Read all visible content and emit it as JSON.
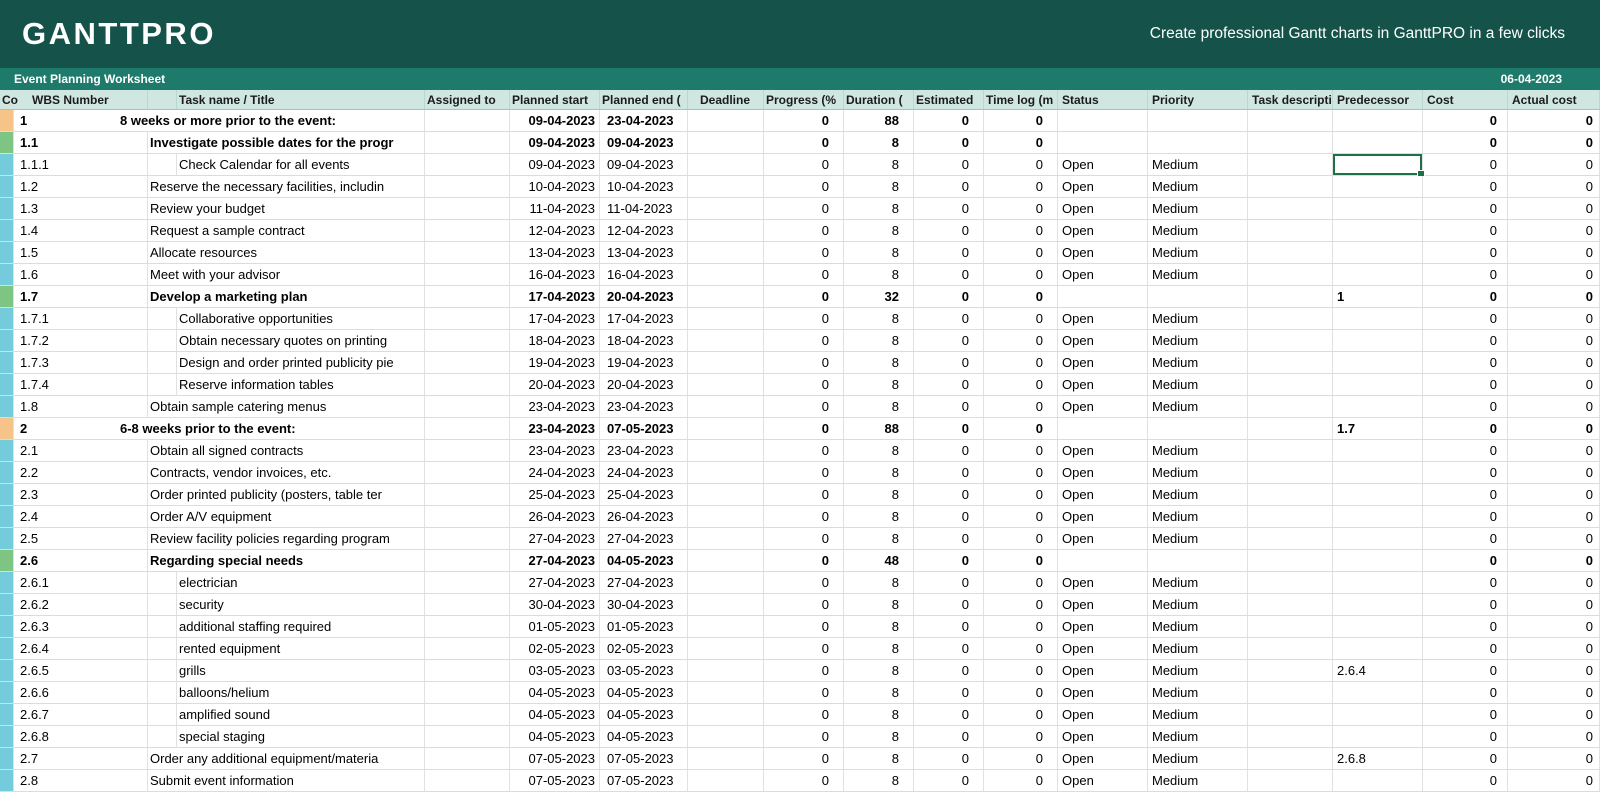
{
  "brand": {
    "logo": "GANTTPRO",
    "tagline": "Create professional Gantt charts in GanttPRO in a few clicks"
  },
  "title_bar": {
    "title": "Event Planning Worksheet",
    "date": "06-04-2023"
  },
  "colors": {
    "orange": "#F6C489",
    "green": "#7EC584",
    "blue": "#74CBDB",
    "top_bar": "#15524A",
    "title_bar": "#1E7A6A",
    "header_row_bg": "#CFE6E1",
    "selection_border": "#1E7145",
    "gridline": "#D9D9D9"
  },
  "table": {
    "columns": [
      {
        "key": "color",
        "label": "Co"
      },
      {
        "key": "wbs",
        "label": "WBS Number"
      },
      {
        "key": "indent",
        "label": ""
      },
      {
        "key": "task",
        "label": "Task name / Title"
      },
      {
        "key": "assigned",
        "label": "Assigned to"
      },
      {
        "key": "planned_start",
        "label": "Planned start"
      },
      {
        "key": "planned_end",
        "label": "Planned end ("
      },
      {
        "key": "deadline",
        "label": "Deadline"
      },
      {
        "key": "progress",
        "label": "Progress (%"
      },
      {
        "key": "duration",
        "label": "Duration  ("
      },
      {
        "key": "estimated",
        "label": "Estimated"
      },
      {
        "key": "timelog",
        "label": "Time log (m"
      },
      {
        "key": "status",
        "label": "Status"
      },
      {
        "key": "priority",
        "label": "Priority"
      },
      {
        "key": "task_desc",
        "label": "Task descripti"
      },
      {
        "key": "predecessor",
        "label": "Predecessor"
      },
      {
        "key": "cost",
        "label": "Cost"
      },
      {
        "key": "actual_cost",
        "label": "Actual cost"
      }
    ],
    "rows": [
      {
        "wbs": "1",
        "level": 1,
        "bold": true,
        "color": "orange",
        "task": "8 weeks or more prior to the event:",
        "planned_start": "09-04-2023",
        "planned_end": "23-04-2023",
        "progress": "0",
        "duration": "88",
        "estimated": "0",
        "timelog": "0",
        "status": "",
        "priority": "",
        "predecessor": "",
        "cost": "0",
        "actual_cost": "0"
      },
      {
        "wbs": "1.1",
        "level": 2,
        "bold": true,
        "color": "green",
        "task": "Investigate possible dates for the progr",
        "planned_start": "09-04-2023",
        "planned_end": "09-04-2023",
        "progress": "0",
        "duration": "8",
        "estimated": "0",
        "timelog": "0",
        "status": "",
        "priority": "",
        "predecessor": "",
        "cost": "0",
        "actual_cost": "0"
      },
      {
        "wbs": "1.1.1",
        "level": 3,
        "bold": false,
        "color": "blue",
        "task": "Check Calendar for all events",
        "planned_start": "09-04-2023",
        "planned_end": "09-04-2023",
        "progress": "0",
        "duration": "8",
        "estimated": "0",
        "timelog": "0",
        "status": "Open",
        "priority": "Medium",
        "predecessor": "",
        "cost": "0",
        "actual_cost": "0",
        "selected": "predecessor"
      },
      {
        "wbs": "1.2",
        "level": 2,
        "bold": false,
        "color": "blue",
        "task": "Reserve the necessary facilities, includin",
        "planned_start": "10-04-2023",
        "planned_end": "10-04-2023",
        "progress": "0",
        "duration": "8",
        "estimated": "0",
        "timelog": "0",
        "status": "Open",
        "priority": "Medium",
        "predecessor": "",
        "cost": "0",
        "actual_cost": "0"
      },
      {
        "wbs": "1.3",
        "level": 2,
        "bold": false,
        "color": "blue",
        "task": "Review your budget",
        "planned_start": "11-04-2023",
        "planned_end": "11-04-2023",
        "progress": "0",
        "duration": "8",
        "estimated": "0",
        "timelog": "0",
        "status": "Open",
        "priority": "Medium",
        "predecessor": "",
        "cost": "0",
        "actual_cost": "0"
      },
      {
        "wbs": "1.4",
        "level": 2,
        "bold": false,
        "color": "blue",
        "task": "Request a sample contract",
        "planned_start": "12-04-2023",
        "planned_end": "12-04-2023",
        "progress": "0",
        "duration": "8",
        "estimated": "0",
        "timelog": "0",
        "status": "Open",
        "priority": "Medium",
        "predecessor": "",
        "cost": "0",
        "actual_cost": "0"
      },
      {
        "wbs": "1.5",
        "level": 2,
        "bold": false,
        "color": "blue",
        "task": "Allocate resources",
        "planned_start": "13-04-2023",
        "planned_end": "13-04-2023",
        "progress": "0",
        "duration": "8",
        "estimated": "0",
        "timelog": "0",
        "status": "Open",
        "priority": "Medium",
        "predecessor": "",
        "cost": "0",
        "actual_cost": "0"
      },
      {
        "wbs": "1.6",
        "level": 2,
        "bold": false,
        "color": "blue",
        "task": "Meet with your advisor",
        "planned_start": "16-04-2023",
        "planned_end": "16-04-2023",
        "progress": "0",
        "duration": "8",
        "estimated": "0",
        "timelog": "0",
        "status": "Open",
        "priority": "Medium",
        "predecessor": "",
        "cost": "0",
        "actual_cost": "0"
      },
      {
        "wbs": "1.7",
        "level": 2,
        "bold": true,
        "color": "green",
        "task": "Develop a marketing plan",
        "planned_start": "17-04-2023",
        "planned_end": "20-04-2023",
        "progress": "0",
        "duration": "32",
        "estimated": "0",
        "timelog": "0",
        "status": "",
        "priority": "",
        "predecessor": "1",
        "cost": "0",
        "actual_cost": "0"
      },
      {
        "wbs": "1.7.1",
        "level": 3,
        "bold": false,
        "color": "blue",
        "task": "Collaborative opportunities",
        "planned_start": "17-04-2023",
        "planned_end": "17-04-2023",
        "progress": "0",
        "duration": "8",
        "estimated": "0",
        "timelog": "0",
        "status": "Open",
        "priority": "Medium",
        "predecessor": "",
        "cost": "0",
        "actual_cost": "0"
      },
      {
        "wbs": "1.7.2",
        "level": 3,
        "bold": false,
        "color": "blue",
        "task": "Obtain necessary quotes on printing",
        "planned_start": "18-04-2023",
        "planned_end": "18-04-2023",
        "progress": "0",
        "duration": "8",
        "estimated": "0",
        "timelog": "0",
        "status": "Open",
        "priority": "Medium",
        "predecessor": "",
        "cost": "0",
        "actual_cost": "0"
      },
      {
        "wbs": "1.7.3",
        "level": 3,
        "bold": false,
        "color": "blue",
        "task": "Design and order printed publicity pie",
        "planned_start": "19-04-2023",
        "planned_end": "19-04-2023",
        "progress": "0",
        "duration": "8",
        "estimated": "0",
        "timelog": "0",
        "status": "Open",
        "priority": "Medium",
        "predecessor": "",
        "cost": "0",
        "actual_cost": "0"
      },
      {
        "wbs": "1.7.4",
        "level": 3,
        "bold": false,
        "color": "blue",
        "task": "Reserve information tables",
        "planned_start": "20-04-2023",
        "planned_end": "20-04-2023",
        "progress": "0",
        "duration": "8",
        "estimated": "0",
        "timelog": "0",
        "status": "Open",
        "priority": "Medium",
        "predecessor": "",
        "cost": "0",
        "actual_cost": "0"
      },
      {
        "wbs": "1.8",
        "level": 2,
        "bold": false,
        "color": "blue",
        "task": "Obtain sample catering menus",
        "planned_start": "23-04-2023",
        "planned_end": "23-04-2023",
        "progress": "0",
        "duration": "8",
        "estimated": "0",
        "timelog": "0",
        "status": "Open",
        "priority": "Medium",
        "predecessor": "",
        "cost": "0",
        "actual_cost": "0"
      },
      {
        "wbs": "2",
        "level": 1,
        "bold": true,
        "color": "orange",
        "task": "6-8 weeks prior to the event:",
        "planned_start": "23-04-2023",
        "planned_end": "07-05-2023",
        "progress": "0",
        "duration": "88",
        "estimated": "0",
        "timelog": "0",
        "status": "",
        "priority": "",
        "predecessor": "1.7",
        "cost": "0",
        "actual_cost": "0"
      },
      {
        "wbs": "2.1",
        "level": 2,
        "bold": false,
        "color": "blue",
        "task": "Obtain all signed contracts",
        "planned_start": "23-04-2023",
        "planned_end": "23-04-2023",
        "progress": "0",
        "duration": "8",
        "estimated": "0",
        "timelog": "0",
        "status": "Open",
        "priority": "Medium",
        "predecessor": "",
        "cost": "0",
        "actual_cost": "0"
      },
      {
        "wbs": "2.2",
        "level": 2,
        "bold": false,
        "color": "blue",
        "task": "Contracts, vendor invoices, etc.",
        "planned_start": "24-04-2023",
        "planned_end": "24-04-2023",
        "progress": "0",
        "duration": "8",
        "estimated": "0",
        "timelog": "0",
        "status": "Open",
        "priority": "Medium",
        "predecessor": "",
        "cost": "0",
        "actual_cost": "0"
      },
      {
        "wbs": "2.3",
        "level": 2,
        "bold": false,
        "color": "blue",
        "task": "Order printed publicity (posters, table ter",
        "planned_start": "25-04-2023",
        "planned_end": "25-04-2023",
        "progress": "0",
        "duration": "8",
        "estimated": "0",
        "timelog": "0",
        "status": "Open",
        "priority": "Medium",
        "predecessor": "",
        "cost": "0",
        "actual_cost": "0"
      },
      {
        "wbs": "2.4",
        "level": 2,
        "bold": false,
        "color": "blue",
        "task": "Order A/V equipment",
        "planned_start": "26-04-2023",
        "planned_end": "26-04-2023",
        "progress": "0",
        "duration": "8",
        "estimated": "0",
        "timelog": "0",
        "status": "Open",
        "priority": "Medium",
        "predecessor": "",
        "cost": "0",
        "actual_cost": "0"
      },
      {
        "wbs": "2.5",
        "level": 2,
        "bold": false,
        "color": "blue",
        "task": "Review facility policies regarding program",
        "planned_start": "27-04-2023",
        "planned_end": "27-04-2023",
        "progress": "0",
        "duration": "8",
        "estimated": "0",
        "timelog": "0",
        "status": "Open",
        "priority": "Medium",
        "predecessor": "",
        "cost": "0",
        "actual_cost": "0"
      },
      {
        "wbs": "2.6",
        "level": 2,
        "bold": true,
        "color": "green",
        "task": "Regarding special needs",
        "planned_start": "27-04-2023",
        "planned_end": "04-05-2023",
        "progress": "0",
        "duration": "48",
        "estimated": "0",
        "timelog": "0",
        "status": "",
        "priority": "",
        "predecessor": "",
        "cost": "0",
        "actual_cost": "0"
      },
      {
        "wbs": "2.6.1",
        "level": 3,
        "bold": false,
        "color": "blue",
        "task": "electrician",
        "planned_start": "27-04-2023",
        "planned_end": "27-04-2023",
        "progress": "0",
        "duration": "8",
        "estimated": "0",
        "timelog": "0",
        "status": "Open",
        "priority": "Medium",
        "predecessor": "",
        "cost": "0",
        "actual_cost": "0"
      },
      {
        "wbs": "2.6.2",
        "level": 3,
        "bold": false,
        "color": "blue",
        "task": "security",
        "planned_start": "30-04-2023",
        "planned_end": "30-04-2023",
        "progress": "0",
        "duration": "8",
        "estimated": "0",
        "timelog": "0",
        "status": "Open",
        "priority": "Medium",
        "predecessor": "",
        "cost": "0",
        "actual_cost": "0"
      },
      {
        "wbs": "2.6.3",
        "level": 3,
        "bold": false,
        "color": "blue",
        "task": "additional staffing required",
        "planned_start": "01-05-2023",
        "planned_end": "01-05-2023",
        "progress": "0",
        "duration": "8",
        "estimated": "0",
        "timelog": "0",
        "status": "Open",
        "priority": "Medium",
        "predecessor": "",
        "cost": "0",
        "actual_cost": "0"
      },
      {
        "wbs": "2.6.4",
        "level": 3,
        "bold": false,
        "color": "blue",
        "task": "rented equipment",
        "planned_start": "02-05-2023",
        "planned_end": "02-05-2023",
        "progress": "0",
        "duration": "8",
        "estimated": "0",
        "timelog": "0",
        "status": "Open",
        "priority": "Medium",
        "predecessor": "",
        "cost": "0",
        "actual_cost": "0"
      },
      {
        "wbs": "2.6.5",
        "level": 3,
        "bold": false,
        "color": "blue",
        "task": "grills",
        "planned_start": "03-05-2023",
        "planned_end": "03-05-2023",
        "progress": "0",
        "duration": "8",
        "estimated": "0",
        "timelog": "0",
        "status": "Open",
        "priority": "Medium",
        "predecessor": "2.6.4",
        "cost": "0",
        "actual_cost": "0"
      },
      {
        "wbs": "2.6.6",
        "level": 3,
        "bold": false,
        "color": "blue",
        "task": "balloons/helium",
        "planned_start": "04-05-2023",
        "planned_end": "04-05-2023",
        "progress": "0",
        "duration": "8",
        "estimated": "0",
        "timelog": "0",
        "status": "Open",
        "priority": "Medium",
        "predecessor": "",
        "cost": "0",
        "actual_cost": "0"
      },
      {
        "wbs": "2.6.7",
        "level": 3,
        "bold": false,
        "color": "blue",
        "task": "amplified sound",
        "planned_start": "04-05-2023",
        "planned_end": "04-05-2023",
        "progress": "0",
        "duration": "8",
        "estimated": "0",
        "timelog": "0",
        "status": "Open",
        "priority": "Medium",
        "predecessor": "",
        "cost": "0",
        "actual_cost": "0"
      },
      {
        "wbs": "2.6.8",
        "level": 3,
        "bold": false,
        "color": "blue",
        "task": "special staging",
        "planned_start": "04-05-2023",
        "planned_end": "04-05-2023",
        "progress": "0",
        "duration": "8",
        "estimated": "0",
        "timelog": "0",
        "status": "Open",
        "priority": "Medium",
        "predecessor": "",
        "cost": "0",
        "actual_cost": "0"
      },
      {
        "wbs": "2.7",
        "level": 2,
        "bold": false,
        "color": "blue",
        "task": "Order any additional equipment/materia",
        "planned_start": "07-05-2023",
        "planned_end": "07-05-2023",
        "progress": "0",
        "duration": "8",
        "estimated": "0",
        "timelog": "0",
        "status": "Open",
        "priority": "Medium",
        "predecessor": "2.6.8",
        "cost": "0",
        "actual_cost": "0"
      },
      {
        "wbs": "2.8",
        "level": 2,
        "bold": false,
        "color": "blue",
        "task": "Submit event information",
        "planned_start": "07-05-2023",
        "planned_end": "07-05-2023",
        "progress": "0",
        "duration": "8",
        "estimated": "0",
        "timelog": "0",
        "status": "Open",
        "priority": "Medium",
        "predecessor": "",
        "cost": "0",
        "actual_cost": "0"
      }
    ]
  }
}
